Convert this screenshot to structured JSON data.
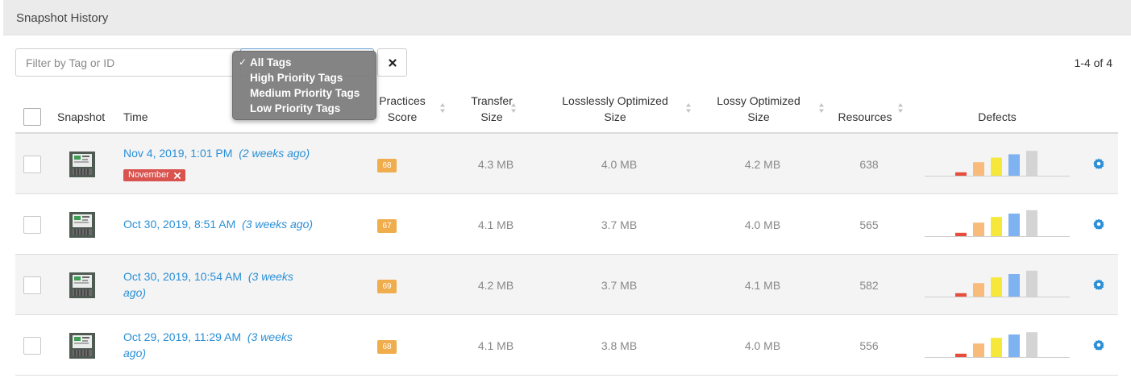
{
  "panel": {
    "title": "Snapshot History"
  },
  "filter": {
    "placeholder": "Filter by Tag or ID",
    "dropdown_options": [
      "All Tags",
      "High Priority Tags",
      "Medium Priority Tags",
      "Low Priority Tags"
    ],
    "selected": "All Tags",
    "check_mark": "✓"
  },
  "pager": {
    "text": "1-4 of 4"
  },
  "columns": {
    "snapshot": "Snapshot",
    "time": "Time",
    "practices_line1": "Practices",
    "practices_line2": "Score",
    "transfer_line1": "Transfer",
    "transfer_line2": "Size",
    "lossless_line1": "Losslessly Optimized",
    "lossless_line2": "Size",
    "lossy_line1": "Lossy Optimized",
    "lossy_line2": "Size",
    "resources": "Resources",
    "defects": "Defects"
  },
  "colors": {
    "link": "#2a8fd6",
    "score_badge": "#f0ad4e",
    "tag_badge": "#d9534f",
    "defect_bars": [
      "#e74c3c",
      "#f8bb7c",
      "#f5e83a",
      "#7fb2f0",
      "#d4d4d4"
    ]
  },
  "rows": [
    {
      "time": "Nov 4, 2019, 1:01 PM",
      "ago": "(2 weeks ago)",
      "tag": "November",
      "score": "68",
      "transfer": "4.3 MB",
      "lossless": "4.0 MB",
      "lossy": "4.2 MB",
      "resources": "638",
      "defects": [
        3,
        12,
        16,
        19,
        22
      ]
    },
    {
      "time": "Oct 30, 2019, 8:51 AM",
      "ago": "(3 weeks ago)",
      "score": "67",
      "transfer": "4.1 MB",
      "lossless": "3.7 MB",
      "lossy": "4.0 MB",
      "resources": "565",
      "defects": [
        3,
        12,
        17,
        20,
        23
      ]
    },
    {
      "time": "Oct 30, 2019, 10:54 AM",
      "ago": "(3 weeks ago)",
      "score": "69",
      "transfer": "4.2 MB",
      "lossless": "3.7 MB",
      "lossy": "4.1 MB",
      "resources": "582",
      "defects": [
        3,
        12,
        17,
        20,
        23
      ]
    },
    {
      "time": "Oct 29, 2019, 11:29 AM",
      "ago": "(3 weeks ago)",
      "score": "68",
      "transfer": "4.1 MB",
      "lossless": "3.8 MB",
      "lossy": "4.0 MB",
      "resources": "556",
      "defects": [
        3,
        12,
        17,
        20,
        22
      ]
    }
  ]
}
